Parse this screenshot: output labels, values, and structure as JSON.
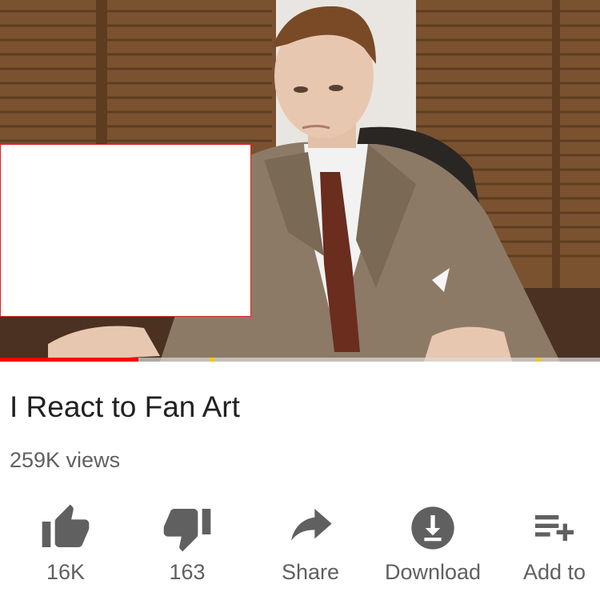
{
  "video": {
    "title": "I React to Fan Art",
    "views": "259K views",
    "progress": 0.23
  },
  "actions": {
    "like": {
      "label": "16K",
      "icon": "thumbs-up-icon"
    },
    "dislike": {
      "label": "163",
      "icon": "thumbs-down-icon"
    },
    "share": {
      "label": "Share",
      "icon": "share-arrow-icon"
    },
    "download": {
      "label": "Download",
      "icon": "download-icon"
    },
    "add_to": {
      "label": "Add to",
      "icon": "playlist-add-icon"
    }
  },
  "colors": {
    "progress": "#ff0000",
    "icon": "#606060",
    "title": "#212121"
  }
}
